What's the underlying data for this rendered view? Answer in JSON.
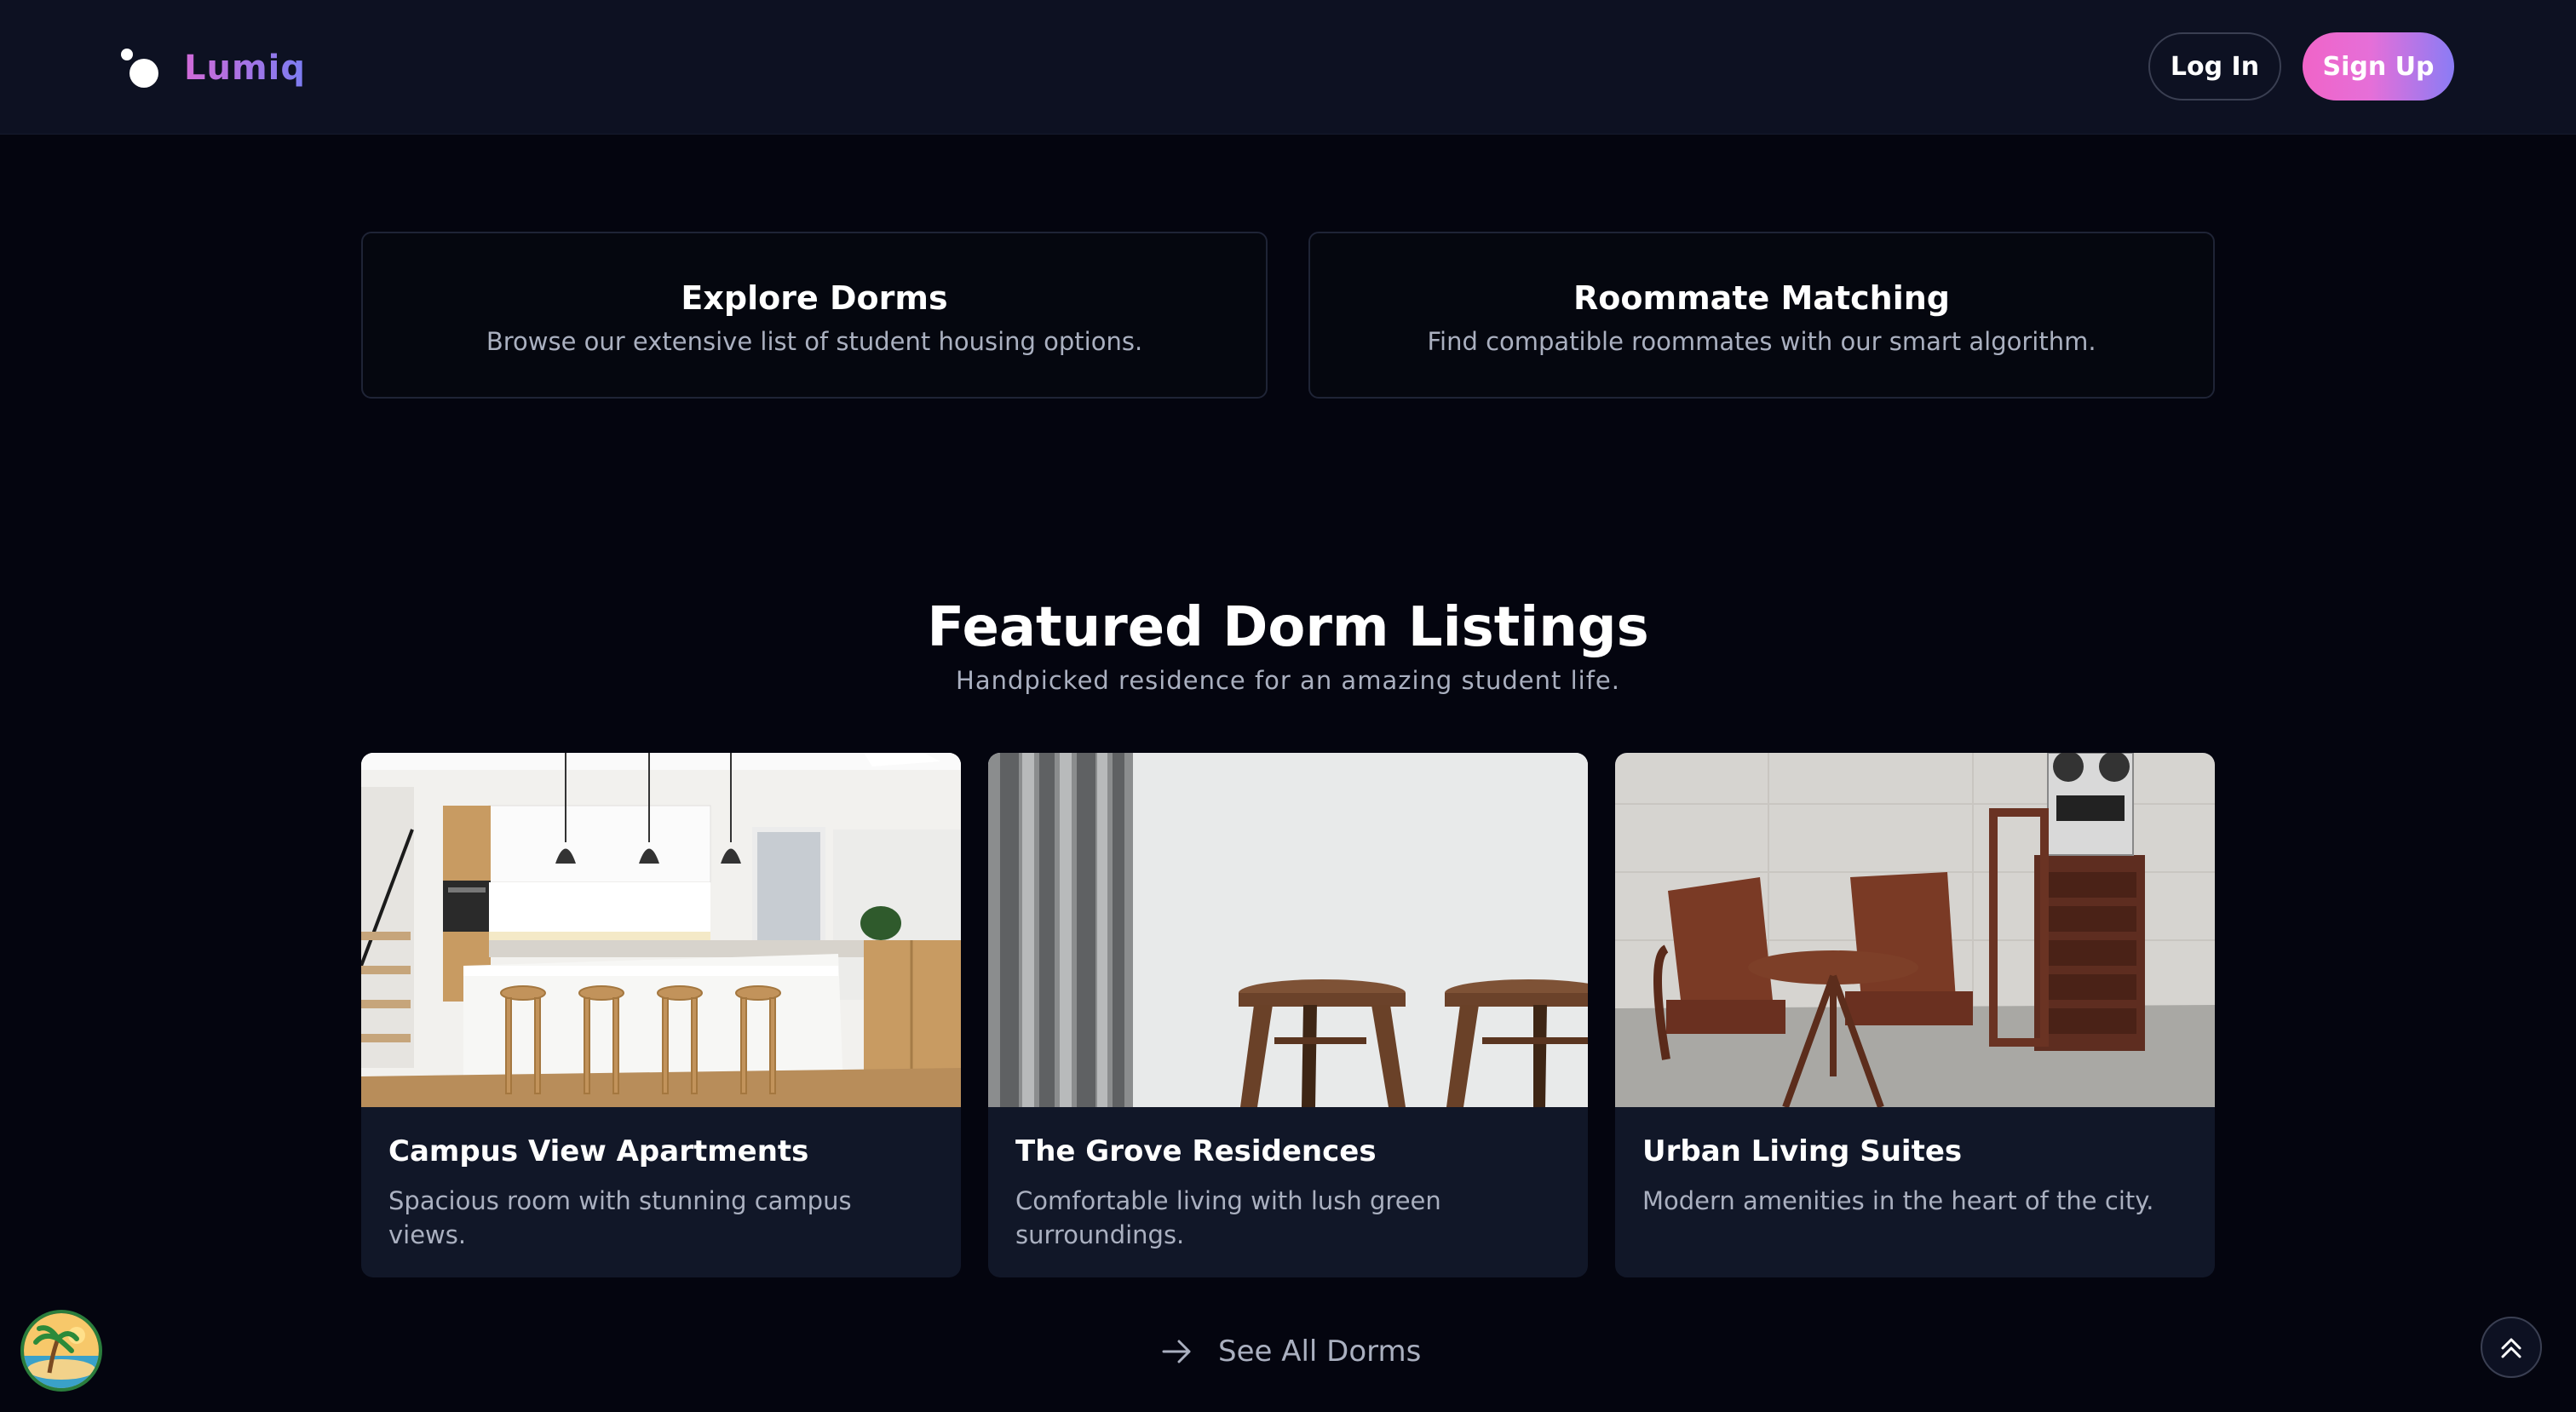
{
  "header": {
    "brand": "Lumiq",
    "login_label": "Log In",
    "signup_label": "Sign Up"
  },
  "features": [
    {
      "title": "Explore Dorms",
      "description": "Browse our extensive list of student housing options."
    },
    {
      "title": "Roommate Matching",
      "description": "Find compatible roommates with our smart algorithm."
    }
  ],
  "listings_section": {
    "title": "Featured Dorm Listings",
    "subtitle": "Handpicked residence for an amazing student life.",
    "see_all_label": "See All Dorms"
  },
  "listings": [
    {
      "name": "Campus View Apartments",
      "description": "Spacious room with stunning campus views."
    },
    {
      "name": "The Grove Residences",
      "description": "Comfortable living with lush green surroundings."
    },
    {
      "name": "Urban Living Suites",
      "description": "Modern amenities in the heart of the city."
    }
  ],
  "icons": {
    "logo": "lumiq-logo-icon",
    "see_all": "arrow-right-icon",
    "scroll_top": "double-chevron-up-icon",
    "avatar": "beach-avatar-icon"
  },
  "colors": {
    "background": "#04050f",
    "header": "#0d1122",
    "card": "#111728",
    "brand_gradient_start": "#d16ad8",
    "brand_gradient_end": "#7b7df2",
    "muted_text": "#aab0c0"
  }
}
